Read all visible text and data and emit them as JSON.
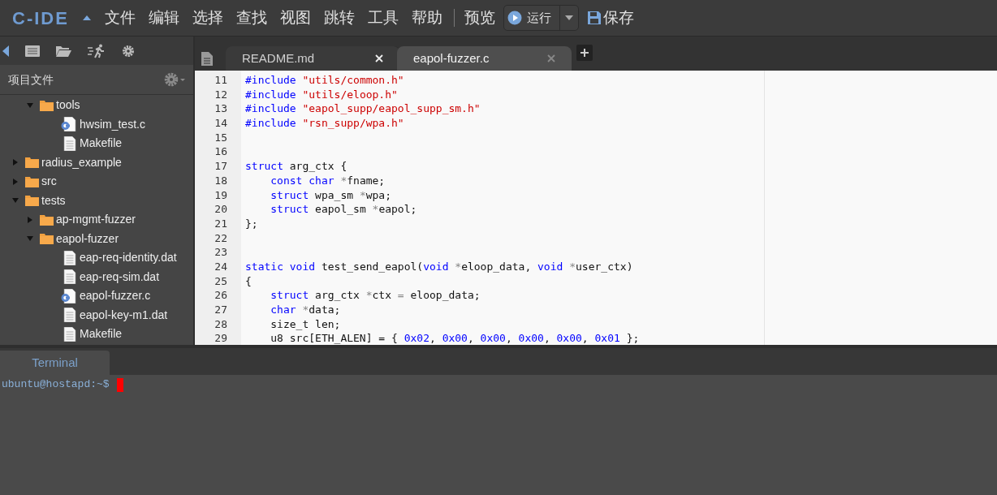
{
  "app": {
    "logo": "C-IDE",
    "menus": [
      "文件",
      "编辑",
      "选择",
      "查找",
      "视图",
      "跳转",
      "工具",
      "帮助"
    ],
    "preview": "预览",
    "run": "运行",
    "save": "保存"
  },
  "sidebar": {
    "title": "项目文件",
    "tree": [
      {
        "children": [
          {
            "label": "tools",
            "kind": "folder",
            "expanded": true,
            "children": [
              {
                "label": "hwsim_test.c",
                "kind": "c_file"
              },
              {
                "label": "Makefile",
                "kind": "file"
              }
            ]
          }
        ]
      },
      {
        "label": "radius_example",
        "kind": "folder",
        "expanded": false
      },
      {
        "label": "src",
        "kind": "folder",
        "expanded": false
      },
      {
        "label": "tests",
        "kind": "folder",
        "expanded": true,
        "children": [
          {
            "label": "ap-mgmt-fuzzer",
            "kind": "folder",
            "expanded": false
          },
          {
            "label": "eapol-fuzzer",
            "kind": "folder",
            "expanded": true,
            "children": [
              {
                "label": "eap-req-identity.dat",
                "kind": "file"
              },
              {
                "label": "eap-req-sim.dat",
                "kind": "file"
              },
              {
                "label": "eapol-fuzzer.c",
                "kind": "c_file"
              },
              {
                "label": "eapol-key-m1.dat",
                "kind": "file"
              },
              {
                "label": "Makefile",
                "kind": "file"
              }
            ]
          }
        ]
      }
    ]
  },
  "tabs": [
    {
      "label": "README.md",
      "selected": false
    },
    {
      "label": "eapol-fuzzer.c",
      "selected": true
    }
  ],
  "code": [
    {
      "number": "11",
      "tokens": [
        {
          "kind": "meta",
          "text": "#include"
        },
        {
          "kind": "string",
          "text": " \"utils/common.h\""
        }
      ]
    },
    {
      "number": "12",
      "tokens": [
        {
          "kind": "meta",
          "text": "#include"
        },
        {
          "kind": "string",
          "text": " \"utils/eloop.h\""
        }
      ]
    },
    {
      "number": "13",
      "tokens": [
        {
          "kind": "meta",
          "text": "#include"
        },
        {
          "kind": "string",
          "text": " \"eapol_supp/eapol_supp_sm.h\""
        }
      ]
    },
    {
      "number": "14",
      "tokens": [
        {
          "kind": "meta",
          "text": "#include"
        },
        {
          "kind": "string",
          "text": " \"rsn_supp/wpa.h\""
        }
      ]
    },
    {
      "number": "15"
    },
    {
      "number": "16"
    },
    {
      "number": "17",
      "tokens": [
        {
          "kind": "keyword",
          "text": "struct"
        },
        {
          "kind": "plain",
          "text": " arg_ctx {"
        }
      ]
    },
    {
      "number": "18",
      "indented": true,
      "tokens": [
        {
          "kind": "keyword",
          "text": "const char"
        },
        {
          "kind": "operator",
          "text": " *"
        },
        {
          "kind": "plain",
          "text": "fname;"
        }
      ]
    },
    {
      "number": "19",
      "indented": true,
      "tokens": [
        {
          "kind": "keyword",
          "text": "struct"
        },
        {
          "kind": "plain",
          "text": " wpa_sm "
        },
        {
          "kind": "operator",
          "text": "*"
        },
        {
          "kind": "plain",
          "text": "wpa;"
        }
      ]
    },
    {
      "number": "20",
      "indented": true,
      "tokens": [
        {
          "kind": "keyword",
          "text": "struct"
        },
        {
          "kind": "plain",
          "text": " eapol_sm "
        },
        {
          "kind": "operator",
          "text": "*"
        },
        {
          "kind": "plain",
          "text": "eapol;"
        }
      ]
    },
    {
      "number": "21",
      "tokens": [
        {
          "kind": "plain",
          "text": "};"
        }
      ]
    },
    {
      "number": "22"
    },
    {
      "number": "23"
    },
    {
      "number": "24",
      "tokens": [
        {
          "kind": "keyword",
          "text": "static void"
        },
        {
          "kind": "plain",
          "text": " test_send_eapol("
        },
        {
          "kind": "keyword",
          "text": "void"
        },
        {
          "kind": "operator",
          "text": " *"
        },
        {
          "kind": "plain",
          "text": "eloop_data, "
        },
        {
          "kind": "keyword",
          "text": "void"
        },
        {
          "kind": "operator",
          "text": " *"
        },
        {
          "kind": "plain",
          "text": "user_ctx)"
        }
      ]
    },
    {
      "number": "25",
      "tokens": [
        {
          "kind": "plain",
          "text": "{"
        }
      ]
    },
    {
      "number": "26",
      "indented": true,
      "tokens": [
        {
          "kind": "keyword",
          "text": "struct"
        },
        {
          "kind": "plain",
          "text": " arg_ctx "
        },
        {
          "kind": "operator",
          "text": "*"
        },
        {
          "kind": "plain",
          "text": "ctx "
        },
        {
          "kind": "operator",
          "text": "="
        },
        {
          "kind": "plain",
          "text": " eloop_data;"
        }
      ]
    },
    {
      "number": "27",
      "indented": true,
      "tokens": [
        {
          "kind": "keyword",
          "text": "char"
        },
        {
          "kind": "operator",
          "text": " *"
        },
        {
          "kind": "plain",
          "text": "data;"
        }
      ]
    },
    {
      "number": "28",
      "indented": true,
      "tokens": [
        {
          "kind": "plain",
          "text": "size_t len;"
        }
      ]
    },
    {
      "number": "29",
      "indented": true,
      "tokens": [
        {
          "kind": "plain",
          "text": "u8 src[ETH_ALEN] = { "
        },
        {
          "kind": "number",
          "text": "0x02"
        },
        {
          "kind": "plain",
          "text": ", "
        },
        {
          "kind": "number",
          "text": "0x00"
        },
        {
          "kind": "plain",
          "text": ", "
        },
        {
          "kind": "number",
          "text": "0x00"
        },
        {
          "kind": "plain",
          "text": ", "
        },
        {
          "kind": "number",
          "text": "0x00"
        },
        {
          "kind": "plain",
          "text": ", "
        },
        {
          "kind": "number",
          "text": "0x00"
        },
        {
          "kind": "plain",
          "text": ", "
        },
        {
          "kind": "number",
          "text": "0x01"
        },
        {
          "kind": "plain",
          "text": " };"
        }
      ]
    }
  ],
  "terminal": {
    "tab": "Terminal",
    "prompt": "ubuntu@hostapd:~$"
  }
}
